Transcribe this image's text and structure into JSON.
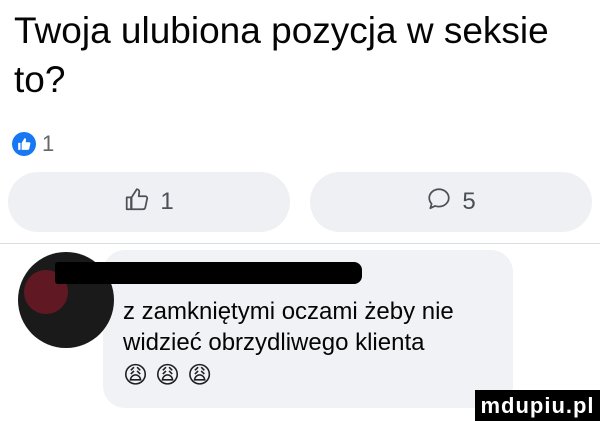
{
  "post": {
    "text": "Twoja ulubiona pozycja w seksie to?",
    "reaction_count": "1"
  },
  "actions": {
    "like_count": "1",
    "comment_count": "5"
  },
  "comment": {
    "text": "z zamkniętymi oczami żeby nie widzieć obrzydliwego klienta",
    "emojis": [
      "😩",
      "😩",
      "😩"
    ]
  },
  "watermark": "mdupiu.pl",
  "colors": {
    "accent": "#1877f2",
    "button_bg": "#eef0f3",
    "bubble_bg": "#f0f2f5",
    "meta_text": "#65676b"
  }
}
